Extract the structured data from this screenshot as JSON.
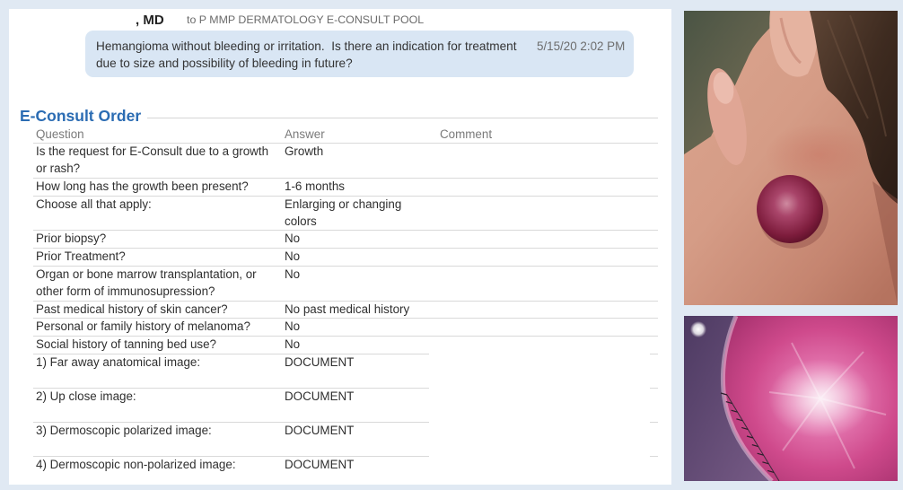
{
  "header": {
    "sender": ", MD",
    "recipient": "to P MMP DERMATOLOGY E-CONSULT POOL"
  },
  "message": {
    "text": "Hemangioma without bleeding or irritation.  Is there an indication for treatment due to size and possibility of bleeding in future?",
    "timestamp": "5/15/20 2:02 PM"
  },
  "order": {
    "title": "E-Consult Order",
    "columns": {
      "question": "Question",
      "answer": "Answer",
      "comment": "Comment"
    },
    "rows": [
      {
        "question": "Is the request for E-Consult due to a growth or rash?",
        "answer": "Growth"
      },
      {
        "question": "How long has the growth been present?",
        "answer": "1-6 months"
      },
      {
        "question": "Choose all that apply:",
        "answer": "Enlarging or changing colors"
      },
      {
        "question": "Prior biopsy?",
        "answer": "No"
      },
      {
        "question": "Prior Treatment?",
        "answer": "No"
      },
      {
        "question": "Organ or bone marrow transplantation, or other form of immunosupression?",
        "answer": "No"
      },
      {
        "question": "Past medical history of skin cancer?",
        "answer": "No past medical history"
      },
      {
        "question": "Personal or family history of melanoma?",
        "answer": "No"
      },
      {
        "question": "Social history of tanning bed use?",
        "answer": "No"
      },
      {
        "question": "1) Far away anatomical image:",
        "answer": "DOCUMENT"
      },
      {
        "question": "2) Up close image:",
        "answer": "DOCUMENT"
      },
      {
        "question": "3) Dermoscopic polarized image:",
        "answer": "DOCUMENT"
      },
      {
        "question": "4) Dermoscopic non-polarized image:",
        "answer": "DOCUMENT"
      }
    ]
  },
  "colors": {
    "accent": "#2b6cb3",
    "bubble": "#d9e6f4",
    "page_background": "#e0e9f3"
  }
}
